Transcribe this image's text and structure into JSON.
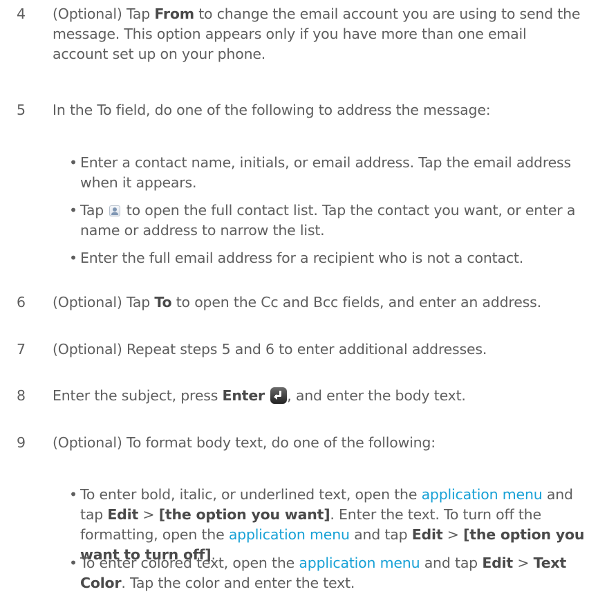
{
  "steps": {
    "s4": {
      "num": "4",
      "p1": "(Optional) Tap ",
      "b1": "From",
      "p2": " to change the email account you are using to send the message. This option appears only if you have more than one email account set up on your phone."
    },
    "s5": {
      "num": "5",
      "text": "In the To field, do one of the following to address the message:",
      "bullets": {
        "b1": {
          "text": "Enter a contact name, initials, or email address. Tap the email address when it appears."
        },
        "b2": {
          "p1": "Tap ",
          "p2": " to open the full contact list. Tap the contact you want, or enter a name or address to narrow the list."
        },
        "b3": {
          "text": "Enter the full email address for a recipient who is not a contact."
        }
      }
    },
    "s6": {
      "num": "6",
      "p1": "(Optional) Tap ",
      "b1": "To",
      "p2": " to open the Cc and Bcc fields, and enter an address."
    },
    "s7": {
      "num": "7",
      "text": "(Optional) Repeat steps 5 and 6 to enter additional addresses."
    },
    "s8": {
      "num": "8",
      "p1": "Enter the subject, press ",
      "b1": "Enter",
      "p2": ", and enter the body text."
    },
    "s9": {
      "num": "9",
      "text": "(Optional) To format body text, do one of the following:",
      "bullets": {
        "b1": {
          "p1": "To enter bold, italic, or underlined text, open the ",
          "link1": "application menu",
          "p2": " and tap ",
          "b1": "Edit",
          "p3": " > ",
          "b2": "[the option you want]",
          "p4": ". Enter the text. To turn off the formatting, open the ",
          "link2": "application menu",
          "p5": " and tap ",
          "b3": "Edit",
          "p6": " > ",
          "b4": "[the option you want to turn off]",
          "p7": "."
        },
        "b2": {
          "p1": "To enter colored text, open the ",
          "link1": "application menu",
          "p2": " and tap ",
          "b1": "Edit",
          "p3": " > ",
          "b2": "Text Color",
          "p4": ". Tap the color and enter the text."
        }
      }
    }
  },
  "bullet_char": "•",
  "icons": {
    "contact": "contact-list-icon",
    "enter": "enter-key-icon"
  },
  "colors": {
    "text": "#5e5e5e",
    "bold": "#4a4a4a",
    "link": "#17a1d6"
  }
}
